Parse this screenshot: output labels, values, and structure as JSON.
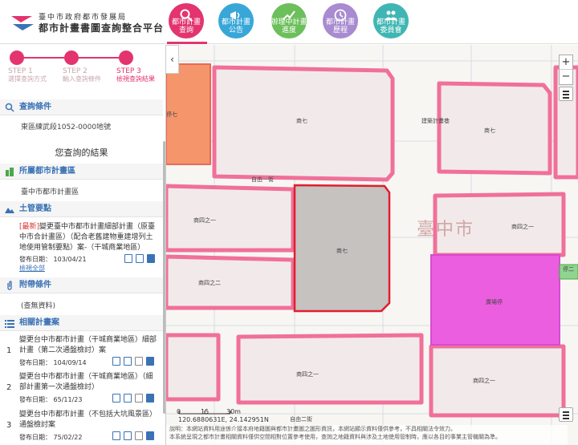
{
  "header": {
    "logo_sub": "臺中市政府都市發展局",
    "logo_main": "都市計畫書圖查詢整合平台",
    "nav": [
      {
        "label1": "都市計畫",
        "label2": "查詢",
        "color": "#e3346f",
        "icon": "search-icon"
      },
      {
        "label1": "都市計畫",
        "label2": "公告",
        "color": "#38a7d8",
        "icon": "megaphone-icon"
      },
      {
        "label1": "辦理中計畫",
        "label2": "進度",
        "color": "#6cbf5a",
        "icon": "chart-icon"
      },
      {
        "label1": "都市計畫",
        "label2": "歷程",
        "color": "#a88bd0",
        "icon": "clock-icon"
      },
      {
        "label1": "都市計畫",
        "label2": "委員會",
        "color": "#3fb6b3",
        "icon": "people-icon"
      }
    ]
  },
  "steps": [
    {
      "step": "STEP 1",
      "label": "選擇查詢方式"
    },
    {
      "step": "STEP 2",
      "label": "輸入查詢條件"
    },
    {
      "step": "STEP 3",
      "label": "檢視查詢結果"
    }
  ],
  "query": {
    "heading": "查詢條件",
    "value": "東區練武段1052-0000地號"
  },
  "results": {
    "title": "您查詢的結果",
    "plan_area_heading": "所屬都市計畫區",
    "plan_area_value": "臺中市都市計畫區",
    "control_heading": "土管要點",
    "control_tag": "[最新]",
    "control_text": "變更臺中市都市計畫細部計畫（原臺中市合計畫區）（配合老舊建物重建增列土地使用管制要點）案-（干城商業地區）",
    "control_date": "發布日期： 103/04/21",
    "control_link": "檢視全部",
    "attach_heading": "附帶條件",
    "attach_value": "(查無資料)",
    "related_heading": "相關計畫案",
    "related": [
      {
        "num": "1",
        "text": "變更台中市都市計畫（干城商業地區）細部計畫（第二次通盤檢討）案",
        "date": "發布日期： 104/09/14"
      },
      {
        "num": "2",
        "text": "變更台中市都市計畫（干城商業地區）（細部計畫第一次通盤檢討）",
        "date": "發布日期： 65/11/23"
      },
      {
        "num": "3",
        "text": "變更台中市都市計畫（不包括大坑風景區）通盤檢討案",
        "date": "發布日期： 75/02/22"
      }
    ]
  },
  "map": {
    "city_label": "臺中市",
    "road_labels": [
      "自由一街",
      "自由二街"
    ],
    "zone_labels": {
      "a": "商七",
      "b": "商七",
      "c": "商七",
      "d": "商四之一",
      "e": "商四之二",
      "f": "商七",
      "g": "商四之一",
      "h": "廣場停",
      "i": "商四之一",
      "j": "商四之一",
      "k": "停七",
      "l": "建築計畫巷",
      "m": "停二"
    },
    "scale_zero": "0",
    "scale_mid": "15",
    "scale_end": "30m",
    "coords": "120.6880631E, 24.142951N",
    "disclaimer_1": "說明：本網站資料用途係介接本府地籍圖與都市計畫圖之圖形資訊，本網站顯示資料僅供參考，不具相關法令效力。",
    "disclaimer_2": "本系統呈現之都市計畫相關資料僅供空間相對位置參考使用，查詢之地籍資料與涉及土地使用管制時，應以各目的事業主管機關為準。",
    "zoom_in": "+",
    "zoom_out": "−",
    "collapse": "‹"
  },
  "colors": {
    "accent": "#e3346f",
    "link": "#3a72b5"
  }
}
